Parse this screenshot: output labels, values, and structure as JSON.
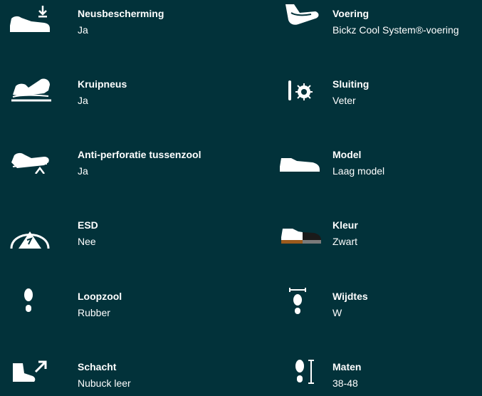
{
  "specs_left": [
    {
      "label": "Neusbescherming",
      "value": "Ja",
      "icon": "safety-toe-shoe-icon"
    },
    {
      "label": "Kruipneus",
      "value": "Ja",
      "icon": "crawl-toe-shoe-icon"
    },
    {
      "label": "Anti-perforatie tussenzool",
      "value": "Ja",
      "icon": "anti-perforation-shoe-icon"
    },
    {
      "label": "ESD",
      "value": "Nee",
      "icon": "esd-warning-icon"
    },
    {
      "label": "Loopzool",
      "value": "Rubber",
      "icon": "footprint-icon"
    },
    {
      "label": "Schacht",
      "value": "Nubuck leer",
      "icon": "boot-shaft-icon"
    }
  ],
  "specs_right": [
    {
      "label": "Voering",
      "value": "Bickz Cool System®-voering",
      "icon": "lining-shoe-icon"
    },
    {
      "label": "Sluiting",
      "value": "Veter",
      "icon": "closure-icon"
    },
    {
      "label": "Model",
      "value": "Laag  model",
      "icon": "low-model-shoe-icon"
    },
    {
      "label": "Kleur",
      "value": "Zwart",
      "icon": "color-shoe-icon"
    },
    {
      "label": "Wijdtes",
      "value": "W",
      "icon": "width-footprint-icon"
    },
    {
      "label": "Maten",
      "value": "38-48",
      "icon": "size-footprint-icon"
    }
  ]
}
